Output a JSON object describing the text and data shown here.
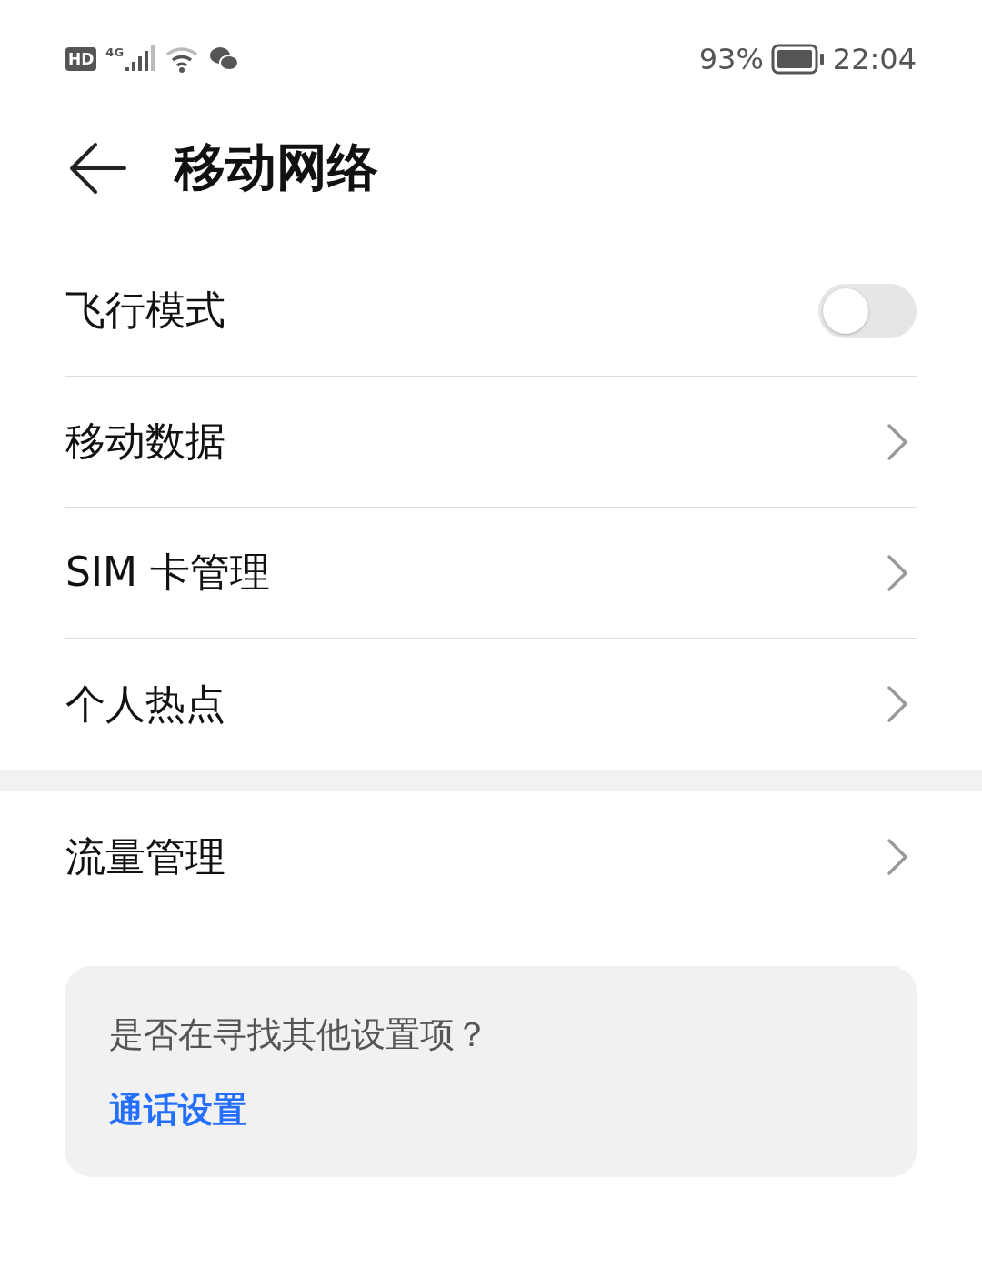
{
  "status_bar": {
    "hd": "HD",
    "network": "4G",
    "battery": "93%",
    "time": "22:04"
  },
  "header": {
    "title": "移动网络"
  },
  "groups": [
    {
      "items": [
        {
          "kind": "toggle",
          "label": "飞行模式",
          "on": false
        },
        {
          "kind": "link",
          "label": "移动数据"
        },
        {
          "kind": "link",
          "label": "SIM 卡管理"
        },
        {
          "kind": "link",
          "label": "个人热点"
        }
      ]
    },
    {
      "items": [
        {
          "kind": "link",
          "label": "流量管理"
        }
      ]
    }
  ],
  "suggestion": {
    "question": "是否在寻找其他设置项？",
    "link": "通话设置"
  }
}
